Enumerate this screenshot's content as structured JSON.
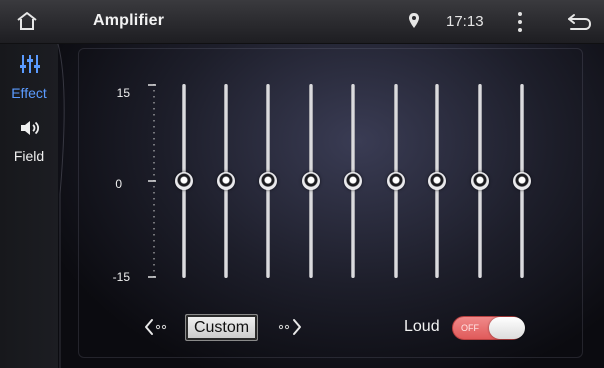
{
  "header": {
    "title": "Amplifier",
    "time": "17:13",
    "home_icon": "home-icon",
    "location_icon": "location-pin-icon",
    "menu_icon": "overflow-menu-icon",
    "back_icon": "back-arrow-icon"
  },
  "sidebar": {
    "items": [
      {
        "label": "Effect",
        "icon": "equalizer-sliders-icon",
        "active": true
      },
      {
        "label": "Field",
        "icon": "speaker-icon",
        "active": false
      }
    ]
  },
  "equalizer": {
    "scale_max": "15",
    "scale_mid": "0",
    "scale_min": "-15",
    "range_db": [
      -15,
      15
    ],
    "band_count": 9,
    "band_values_db": [
      0,
      0,
      0,
      0,
      0,
      0,
      0,
      0,
      0
    ]
  },
  "preset": {
    "current": "Custom",
    "prev_icon": "chevron-left-icon",
    "next_icon": "chevron-right-icon"
  },
  "loudness": {
    "label": "Loud",
    "state_text": "OFF",
    "enabled": false,
    "accent_color": "#e86a6a"
  },
  "colors": {
    "active_tab": "#5b9bff"
  }
}
